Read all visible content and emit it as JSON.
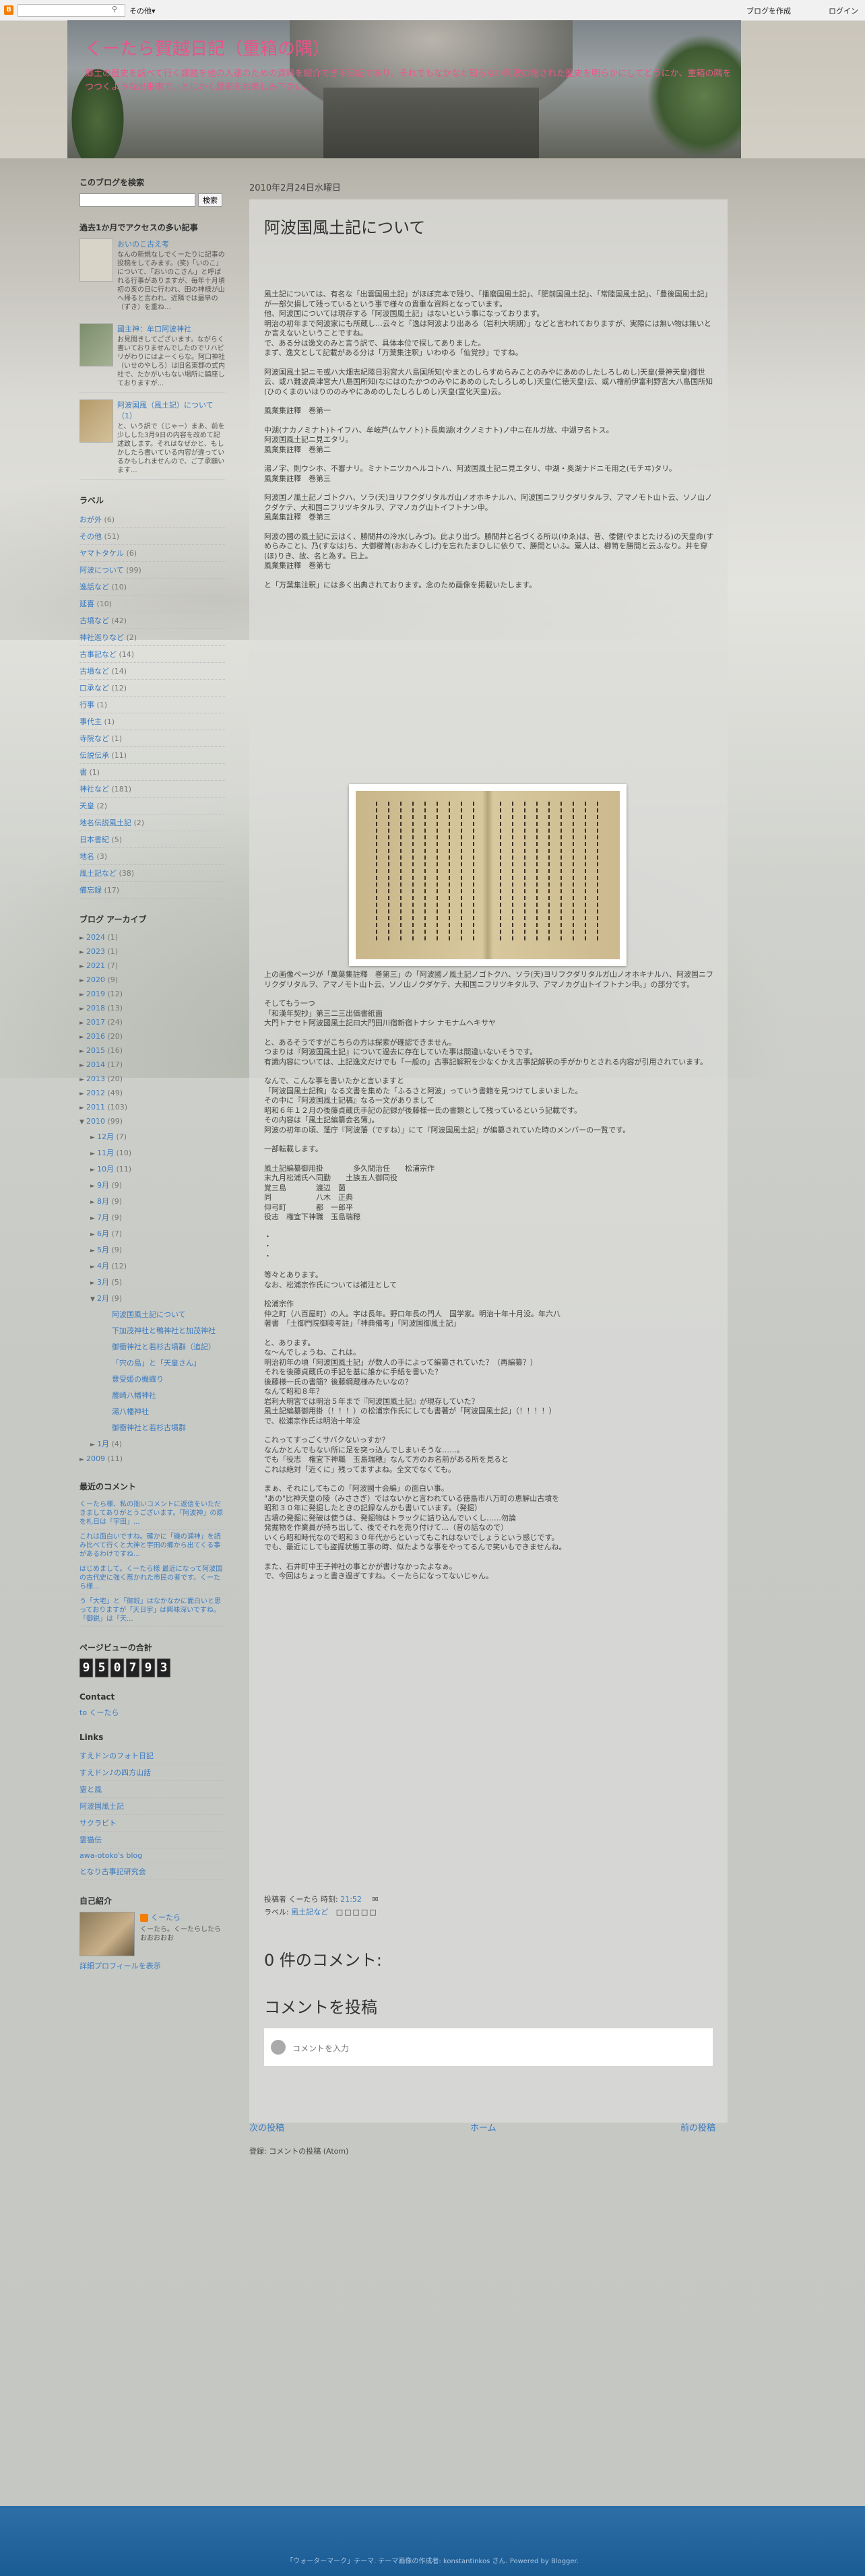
{
  "navbar": {
    "more": "その他▾",
    "create_blog": "ブログを作成",
    "login": "ログイン"
  },
  "header": {
    "title": "くーたら賀越日記（重箱の隅）",
    "description": "郷土の歴史を調べて行く課題を他の人達のための資料を紹介できる日記であり、それでもなかなか知らない阿波の隠された歴史を明らかにしてどうにか、重箱の隅をつつくような出来事で、とにかく歴史をお楽しみ下さい。"
  },
  "sidebar": {
    "search": {
      "heading": "このブログを検索",
      "button": "検索"
    },
    "popular": {
      "heading": "過去1か月でアクセスの多い記事",
      "items": [
        {
          "title": "おいのこ古え考",
          "snippet": "なんの新規なしでくーたりに記事の投稿をしてみます。(笑)「いのこ」について、「おいのこさん」と呼ばれる行事がありますが、毎年十月頃初の亥の日に行われ、田の神様が山へ帰ると言われ、近隣では最早の（ずき）を重ね..."
        },
        {
          "title": "國主神：牟口阿波神社",
          "snippet": "お見聞きしてございます。ながらく書いておりませんでしたのでリハビリがわりにはよーくらな。阿口神社（いせのやしろ）は旧名東郡の式内社で、たかがいもない場所に鎮座しておりますが..."
        },
        {
          "title": "阿波国風（風土記）について（1）",
          "snippet": "と、いう訳で（じゃー）まあ、前を少しした3月9日の内容を改めて記述致します。それはなぜかと、もしかしたら書いている内容が違っているかもしれませんので、ご了承願います..."
        }
      ]
    },
    "labels": {
      "heading": "ラベル",
      "items": [
        {
          "name": "おが外",
          "count": "(6)"
        },
        {
          "name": "その他",
          "count": "(51)"
        },
        {
          "name": "ヤマトタケル",
          "count": "(6)"
        },
        {
          "name": "阿波について",
          "count": "(99)"
        },
        {
          "name": "逸話など",
          "count": "(10)"
        },
        {
          "name": "延喜",
          "count": "(10)"
        },
        {
          "name": "古墳など",
          "count": "(42)"
        },
        {
          "name": "神社巡りなど",
          "count": "(2)"
        },
        {
          "name": "古事記など",
          "count": "(14)"
        },
        {
          "name": "古墳など",
          "count": "(14)"
        },
        {
          "name": "口承など",
          "count": "(12)"
        },
        {
          "name": "行事",
          "count": "(1)"
        },
        {
          "name": "事代主",
          "count": "(1)"
        },
        {
          "name": "寺院など",
          "count": "(1)"
        },
        {
          "name": "伝説伝承",
          "count": "(11)"
        },
        {
          "name": "書",
          "count": "(1)"
        },
        {
          "name": "神社など",
          "count": "(181)"
        },
        {
          "name": "天皇",
          "count": "(2)"
        },
        {
          "name": "地名伝説風土記",
          "count": "(2)"
        },
        {
          "name": "日本書紀",
          "count": "(5)"
        },
        {
          "name": "地名",
          "count": "(3)"
        },
        {
          "name": "風土記など",
          "count": "(38)"
        },
        {
          "name": "備忘録",
          "count": "(17)"
        }
      ]
    },
    "archive": {
      "heading": "ブログ アーカイブ",
      "years": [
        {
          "y": "2024",
          "c": "(1)"
        },
        {
          "y": "2023",
          "c": "(1)"
        },
        {
          "y": "2021",
          "c": "(7)"
        },
        {
          "y": "2020",
          "c": "(9)"
        },
        {
          "y": "2019",
          "c": "(12)"
        },
        {
          "y": "2018",
          "c": "(13)"
        },
        {
          "y": "2017",
          "c": "(24)"
        },
        {
          "y": "2016",
          "c": "(20)"
        },
        {
          "y": "2015",
          "c": "(16)"
        },
        {
          "y": "2014",
          "c": "(17)"
        },
        {
          "y": "2013",
          "c": "(20)"
        },
        {
          "y": "2012",
          "c": "(49)"
        },
        {
          "y": "2011",
          "c": "(103)"
        }
      ],
      "open_year": {
        "y": "2010",
        "c": "(99)"
      },
      "months": [
        {
          "m": "12月",
          "c": "(7)"
        },
        {
          "m": "11月",
          "c": "(10)"
        },
        {
          "m": "10月",
          "c": "(11)"
        },
        {
          "m": "9月",
          "c": "(9)"
        },
        {
          "m": "8月",
          "c": "(9)"
        },
        {
          "m": "7月",
          "c": "(9)"
        },
        {
          "m": "6月",
          "c": "(7)"
        },
        {
          "m": "5月",
          "c": "(9)"
        },
        {
          "m": "4月",
          "c": "(12)"
        },
        {
          "m": "3月",
          "c": "(5)"
        }
      ],
      "open_month": {
        "m": "2月",
        "c": "(9)"
      },
      "posts": [
        "阿波国風土記について",
        "下加茂神社と鴨神社と加茂神社",
        "御衝神社と若杉古墳群（追記）",
        "「宍の島」と「天皇さん」",
        "豊受姫の機織り",
        "農崎八幡神社",
        "湯八幡神社",
        "御衝神社と若杉古墳群"
      ],
      "after": [
        {
          "m": "1月",
          "c": "(4)"
        }
      ],
      "last_year": {
        "y": "2009",
        "c": "(11)"
      }
    },
    "recent_comments": {
      "heading": "最近のコメント",
      "items": [
        "くーたら様、私の拙いコメントに返信をいただきましてありがとうございます。「阿波神」の原を札日は「宇田」...",
        "これは面白いですね。確かに「磯の浦神」を読み比べて行くと大神と宇田の郷から出てくる事があるわけですね...",
        "はじめまして。くーたら様 最近になって阿波国の古代史に強く惹かれた市民の者です。くーたら様...",
        "う「大宅」と「御鋭」はなかなかに面白いと思っておりますが「天日宇」は興味深いですね。「御鋭」は「天..."
      ]
    },
    "counter": {
      "heading": "ページビューの合計",
      "digits": [
        "9",
        "5",
        "0",
        "7",
        "9",
        "3"
      ]
    },
    "contact": {
      "heading": "Contact",
      "link": "to くーたら"
    },
    "links": {
      "heading": "Links",
      "items": [
        "すえドンのフォト日記",
        "すえドン♪の四方山話",
        "霊と風",
        "阿波国風土記",
        "サクラビト",
        "霊猫伝",
        "awa-otoko's blog",
        "となり古事記研究会"
      ]
    },
    "profile": {
      "heading": "自己紹介",
      "name": "くーたら",
      "desc": "くーたら。くーたらしたらおおおおお",
      "link": "詳細プロフィールを表示"
    }
  },
  "main": {
    "date": "2010年2月24日水曜日",
    "title": "阿波国風土記について",
    "paragraphs": [
      "風土記については、有名な「出雲国風土記」がほぼ完本で残り、「播磨国風土記」、「肥前国風土記」、「常陸国風土記」、「豊後国風土記」が一部欠損して残っているという事で様々の貴重な資料となっています。\n他、阿波国については現存する「阿波国風土記」はないという事になっております。\n明治の初年まで阿波家にも所蔵し…云々と「逸は阿波より出ある（岩利大明期）」などと言われておりますが、実際には無い物は無いとか言えないということですね。\nで、ある分は逸文のみと言う訳で、具体本位で探してありました。\nまず、逸文として記載がある分は「万葉集注釈」いわゆる「仙覚抄」ですね。",
      "阿波国風土記ニモ或ハ大畑志紀陸日羽宮大八島国所知(やまとのしらすめらみことのみやにあめのしたしろしめし)天皇(景神天皇)御世云、或ハ難波高津宮大八島国所知(なにはのたかつのみやにあめのしたしろしめし)天皇(仁徳天皇)云、或ハ檜前伊富利野宮大八島国所知(ひのくまのいほりののみやにあめのしたしろしめし)天皇(宣化天皇)云。",
      "風業集註釋　巻第一",
      "中湖(ナカノミナト)トイフハ、牟岐芦(ムヤノト)ト長奥湖(オクノミナト)ノ中ニ在ルガ故、中湖ヲ名トス。\n阿波国風土記ニ見エタリ。\n風業集註釋　巻第二",
      "湯ノ字、則ウシホ、不審ナリ。ミナトニツカヘルコトハ、阿波国風土記ニ見エタリ、中湖・奥湖ナドニモ用之(モチヰ)タリ。\n風業集註釋　巻第三",
      "阿波国ノ風土記ノゴトクハ、ソラ(天)ヨリフクダリタルガ山ノオホキナルハ、阿波国ニフリクダリタルヲ、アマノモト山ト云、ソノ山ノクダケテ、大和国ニフリツキタルヲ、アマノカグ山トイフトナン申。\n風業集註釋　巻第三",
      "阿波の國の風土記に云はく、勝間井の冷水(しみづ)。此より出づ。勝間井と名づくる所以(ゆゑ)は、昔、倭健(やまとたける)の天皇命(すめらみこと)、乃(すなは)ち、大御櫛笥(おおみくしげ)を忘れたまひしに依りて、勝間といふ。粟人は、櫛笥を勝間と云ふなり。井を穿(ほ)りき、故、名と為す。已上。\n風業集註釋　巻第七",
      "と「万葉集注釈」には多く出典されております。念のため画像を掲載いたします。"
    ],
    "caption": "上の画像ページが「萬葉集註釋　巻第三」の「阿波國ノ風土記ノゴトクハ、ソラ(天)ヨリフクダリタルガ山ノオホキナルハ、阿波国ニフリクダリタルヲ、アマノモト山ト云、ソノ山ノクダケテ、大和国ニフリツキタルヲ、アマノカグ山トイフトナン申。」の部分です。",
    "caption2": "そしてもう一つ\n「和漢年契抄」第三二三出価書紙面\n大門トナセト阿波國風土記曰大門田川宿新宿トナシ ナモナムヘキサヤ",
    "paragraphs2": [
      "と、あるそうですがこちらの方は探索が確認できません。\nつまりは『阿波国風土記』について過去に存在していた事は間違いないそうです。\n有識内容については、上記逸文だけでも「一般の」古事記解釈を少なくかえ古事記解釈の手がかりとされる内容が引用されています。",
      "なんで、こんな事を書いたかと言いますと\n「阿波国風土記稿」なる文書を集めた「ふるさと阿波」っていう書籍を見つけてしまいました。\nその中に『阿波国風土記稿』なる一文がありまして\n昭和６年１２月の後藤貞蔵氏手記の記録が後藤様一氏の書類として残っているという記載です。\nその内容は「風土記編纂会名簿」。\n阿波の初年の頃、蓬庁『阿波藩（ですね）』にて『阿波国風土記』が編纂されていた時のメンバーの一覧です。",
      "一部転載します。",
      "風土記編纂御用掛　　　　多久間治任　　松浦宗作\n末九月松浦氏へ同勤　　土族五人御同役\n覚三島　　　　渡辺　菌\n同　　　　　　八木　正典\n仰弓町　　　　都　一郎平\n役志　権宜下神職　玉島瑞穂",
      "・\n・\n・",
      "等々とあります。\nなお、松浦宗作氏については補注として",
      "松浦宗作\n仲之町（八百屋町）の人。字は長年。野口年長の門人　国学家。明治十年十月没。年六八\n著書　「土御門院御陵考註」「神典備考」「阿波国御風土記」",
      "と、あります。\nな～んでしょうね、これは。\n明治初年の頃「阿波国風土記」が数人の手によって編纂されていた？（再編纂？）\nそれを後藤貞蔵氏の手記を基に誰かに手紙を書いた？\n後藤様一氏の書簡？後藤綱蔵様みたいなの？\nなんて昭和８年？\n岩利大明宮では明治５年まで『阿波国風土記』が現存していた？\n風土記編纂御用掛（！！！）の松浦宗作氏にしても書著が「阿波国風土記」（！！！！）\nで、松浦宗作氏は明治十年没",
      "これってすっごくサバクないっすか？\nなんかとんでもない所に足を突っ込んでしまいそうな……。\nでも「役志　権宜下神職　玉島瑞穂」なんて方のお名前がある所を見ると\nこれは絶対「近くに」残ってますよね。全文でなくても。",
      "まぁ、それにしてもこの「阿波國十会編」の面白い事。\n\"あの\"比神天皇の陵（みささぎ）ではないかと言われている徳島市八万町の恵解山古墳を\n昭和３０年に発掘したときの記録なんかも書いています。（発掘）\n古墳の発掘に発破は使うは、発掘物はトラックに詰り込んでいくし……勿論\n発掘物を作業員が持ち出して、後でそれを売り付けて…（昔の話なので）\nいくら昭和時代なので昭和３０年代からといってもこれはないでしょうという感じです。\nでも、最近にしても盗掘状態工事の時、似たような事をやってるんで笑いもできませんね。",
      "また、石井町中王子神社の事とかが書けなかったよなぁ。\nで、今回はちょっと書き過ぎてすね。くーたらになってないじゃん。"
    ],
    "footer": {
      "posted_by": "投稿者 くーたら 時刻:",
      "time": "21:52",
      "labels_label": "ラベル:",
      "label": "風土記など"
    },
    "comments_heading": "0 件のコメント:",
    "post_comment_heading": "コメントを投稿",
    "comment_placeholder": "コメントを入力",
    "pager": {
      "newer": "次の投稿",
      "home": "ホーム",
      "older": "前の投稿"
    },
    "subscribe": "登録: コメントの投稿 (Atom)"
  },
  "footer": {
    "text": "「ウォーターマーク」テーマ. テーマ画像の作成者: konstantinkos さん. Powered by Blogger."
  }
}
